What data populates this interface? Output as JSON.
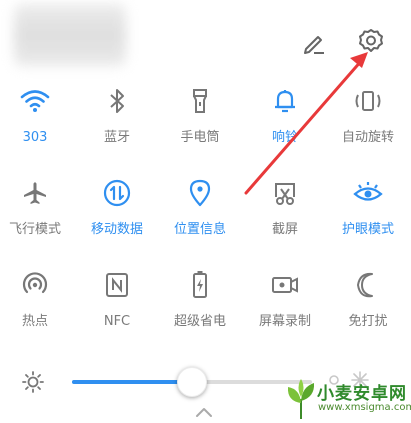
{
  "header": {
    "edit_icon": "pencil-icon",
    "settings_icon": "gear-icon"
  },
  "tiles": [
    {
      "label": "303",
      "icon": "wifi-icon",
      "on": true
    },
    {
      "label": "蓝牙",
      "icon": "bluetooth-icon",
      "on": false
    },
    {
      "label": "手电筒",
      "icon": "flashlight-icon",
      "on": false
    },
    {
      "label": "响铃",
      "icon": "bell-icon",
      "on": true
    },
    {
      "label": "自动旋转",
      "icon": "auto-rotate-icon",
      "on": false
    },
    {
      "label": "飞行模式",
      "icon": "airplane-icon",
      "on": false
    },
    {
      "label": "移动数据",
      "icon": "mobile-data-icon",
      "on": true
    },
    {
      "label": "位置信息",
      "icon": "location-icon",
      "on": true
    },
    {
      "label": "截屏",
      "icon": "screenshot-icon",
      "on": false
    },
    {
      "label": "护眼模式",
      "icon": "eye-icon",
      "on": true
    },
    {
      "label": "热点",
      "icon": "hotspot-icon",
      "on": false
    },
    {
      "label": "NFC",
      "icon": "nfc-icon",
      "on": false
    },
    {
      "label": "超级省电",
      "icon": "battery-saver-icon",
      "on": false
    },
    {
      "label": "屏幕录制",
      "icon": "screen-record-icon",
      "on": false
    },
    {
      "label": "免打扰",
      "icon": "moon-icon",
      "on": false
    }
  ],
  "brightness": {
    "level_fraction": 0.5
  },
  "colors": {
    "accent": "#2f8ff0",
    "inactive": "#7a7a7a",
    "arrow": "#e8393a"
  },
  "watermark": {
    "title": "小麦安卓网",
    "url": "www.xmsigma.com"
  }
}
